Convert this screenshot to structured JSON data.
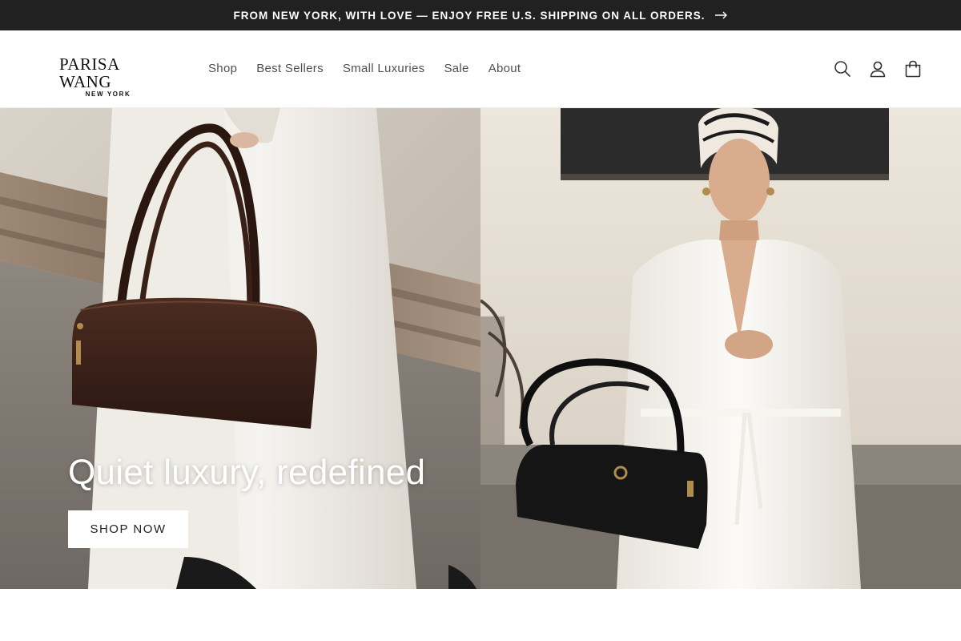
{
  "announcement": {
    "text": "FROM NEW YORK, WITH LOVE — ENJOY FREE U.S. SHIPPING ON ALL ORDERS.",
    "icon": "arrow-right-icon"
  },
  "header": {
    "logo": {
      "main": "PARISA WANG",
      "sub": "NEW YORK"
    },
    "nav": [
      "Shop",
      "Best Sellers",
      "Small Luxuries",
      "Sale",
      "About"
    ],
    "icons": [
      "search-icon",
      "account-icon",
      "cart-icon"
    ]
  },
  "hero": {
    "title": "Quiet luxury, redefined",
    "button": "SHOP NOW"
  },
  "colors": {
    "announcement_bg": "#212121",
    "announcement_text": "#ffffff",
    "nav_text": "#505050",
    "button_bg": "#ffffff"
  }
}
